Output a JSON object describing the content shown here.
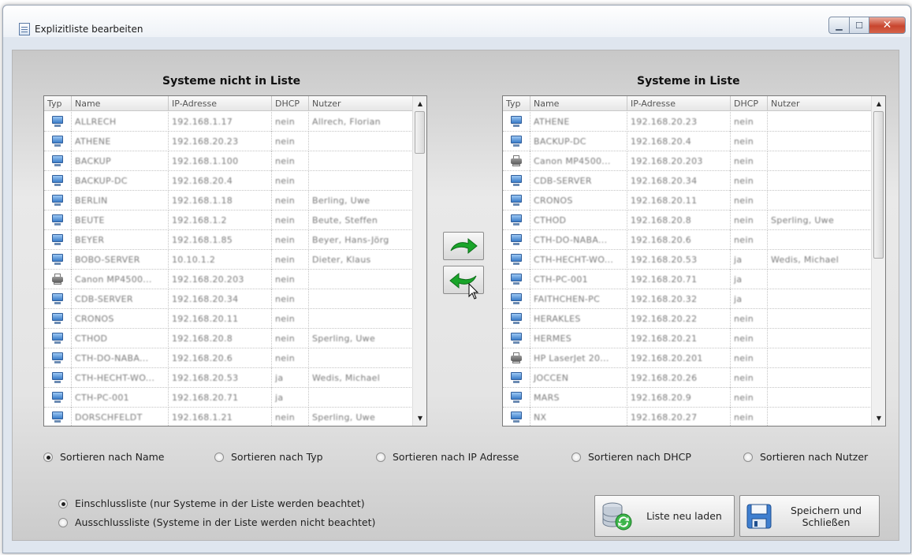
{
  "window": {
    "title": "Explizitliste bearbeiten"
  },
  "left_list": {
    "heading": "Systeme nicht in Liste",
    "columns": [
      "Typ",
      "Name",
      "IP-Adresse",
      "DHCP",
      "Nutzer"
    ],
    "rows": [
      {
        "type": "pc",
        "name": "ALLRECH",
        "ip": "192.168.1.17",
        "dhcp": "nein",
        "user": "Allrech, Florian"
      },
      {
        "type": "pc",
        "name": "ATHENE",
        "ip": "192.168.20.23",
        "dhcp": "nein",
        "user": ""
      },
      {
        "type": "pc",
        "name": "BACKUP",
        "ip": "192.168.1.100",
        "dhcp": "nein",
        "user": ""
      },
      {
        "type": "pc",
        "name": "BACKUP-DC",
        "ip": "192.168.20.4",
        "dhcp": "nein",
        "user": ""
      },
      {
        "type": "pc",
        "name": "BERLIN",
        "ip": "192.168.1.18",
        "dhcp": "nein",
        "user": "Berling, Uwe"
      },
      {
        "type": "pc",
        "name": "BEUTE",
        "ip": "192.168.1.2",
        "dhcp": "nein",
        "user": "Beute, Steffen"
      },
      {
        "type": "pc",
        "name": "BEYER",
        "ip": "192.168.1.85",
        "dhcp": "nein",
        "user": "Beyer, Hans-Jörg"
      },
      {
        "type": "pc",
        "name": "BOBO-SERVER",
        "ip": "10.10.1.2",
        "dhcp": "nein",
        "user": "Dieter, Klaus"
      },
      {
        "type": "pr",
        "name": "Canon MP4500...",
        "ip": "192.168.20.203",
        "dhcp": "nein",
        "user": ""
      },
      {
        "type": "pc",
        "name": "CDB-SERVER",
        "ip": "192.168.20.34",
        "dhcp": "nein",
        "user": ""
      },
      {
        "type": "pc",
        "name": "CRONOS",
        "ip": "192.168.20.11",
        "dhcp": "nein",
        "user": ""
      },
      {
        "type": "pc",
        "name": "CTHOD",
        "ip": "192.168.20.8",
        "dhcp": "nein",
        "user": "Sperling, Uwe"
      },
      {
        "type": "pc",
        "name": "CTH-DO-NABA...",
        "ip": "192.168.20.6",
        "dhcp": "nein",
        "user": ""
      },
      {
        "type": "pc",
        "name": "CTH-HECHT-WO...",
        "ip": "192.168.20.53",
        "dhcp": "ja",
        "user": "Wedis, Michael"
      },
      {
        "type": "pc",
        "name": "CTH-PC-001",
        "ip": "192.168.20.71",
        "dhcp": "ja",
        "user": ""
      },
      {
        "type": "pc",
        "name": "DORSCHFELDT",
        "ip": "192.168.1.21",
        "dhcp": "nein",
        "user": "Sperling, Uwe"
      }
    ]
  },
  "right_list": {
    "heading": "Systeme in Liste",
    "columns": [
      "Typ",
      "Name",
      "IP-Adresse",
      "DHCP",
      "Nutzer"
    ],
    "rows": [
      {
        "type": "pc",
        "name": "ATHENE",
        "ip": "192.168.20.23",
        "dhcp": "nein",
        "user": ""
      },
      {
        "type": "pc",
        "name": "BACKUP-DC",
        "ip": "192.168.20.4",
        "dhcp": "nein",
        "user": ""
      },
      {
        "type": "pr",
        "name": "Canon MP4500...",
        "ip": "192.168.20.203",
        "dhcp": "nein",
        "user": ""
      },
      {
        "type": "pc",
        "name": "CDB-SERVER",
        "ip": "192.168.20.34",
        "dhcp": "nein",
        "user": ""
      },
      {
        "type": "pc",
        "name": "CRONOS",
        "ip": "192.168.20.11",
        "dhcp": "nein",
        "user": ""
      },
      {
        "type": "pc",
        "name": "CTHOD",
        "ip": "192.168.20.8",
        "dhcp": "nein",
        "user": "Sperling, Uwe"
      },
      {
        "type": "pc",
        "name": "CTH-DO-NABA...",
        "ip": "192.168.20.6",
        "dhcp": "nein",
        "user": ""
      },
      {
        "type": "pc",
        "name": "CTH-HECHT-WO...",
        "ip": "192.168.20.53",
        "dhcp": "ja",
        "user": "Wedis, Michael"
      },
      {
        "type": "pc",
        "name": "CTH-PC-001",
        "ip": "192.168.20.71",
        "dhcp": "ja",
        "user": ""
      },
      {
        "type": "pc",
        "name": "FAITHCHEN-PC",
        "ip": "192.168.20.32",
        "dhcp": "ja",
        "user": ""
      },
      {
        "type": "pc",
        "name": "HERAKLES",
        "ip": "192.168.20.22",
        "dhcp": "nein",
        "user": ""
      },
      {
        "type": "pc",
        "name": "HERMES",
        "ip": "192.168.20.21",
        "dhcp": "nein",
        "user": ""
      },
      {
        "type": "pr",
        "name": "HP LaserJet 20...",
        "ip": "192.168.20.201",
        "dhcp": "nein",
        "user": ""
      },
      {
        "type": "pc",
        "name": "JOCCEN",
        "ip": "192.168.20.26",
        "dhcp": "nein",
        "user": ""
      },
      {
        "type": "pc",
        "name": "MARS",
        "ip": "192.168.20.9",
        "dhcp": "nein",
        "user": ""
      },
      {
        "type": "pc",
        "name": "NX",
        "ip": "192.168.20.27",
        "dhcp": "nein",
        "user": ""
      }
    ]
  },
  "move_buttons": {
    "to_right": "move-to-list-icon",
    "to_left": "move-from-list-icon"
  },
  "sort_options": [
    {
      "label": "Sortieren nach Name",
      "checked": true
    },
    {
      "label": "Sortieren nach Typ",
      "checked": false
    },
    {
      "label": "Sortieren nach IP Adresse",
      "checked": false
    },
    {
      "label": "Sortieren nach DHCP",
      "checked": false
    },
    {
      "label": "Sortieren nach Nutzer",
      "checked": false
    }
  ],
  "list_mode": [
    {
      "label": "Einschlussliste (nur Systeme in der Liste werden beachtet)",
      "checked": true
    },
    {
      "label": "Ausschlussliste (Systeme in der Liste werden nicht beachtet)",
      "checked": false
    }
  ],
  "buttons": {
    "reload": "Liste neu laden",
    "save": "Speichern und\nSchließen"
  },
  "colors": {
    "arrow_green": "#1aa52a",
    "window_bg": "#dfe6ef",
    "close_red": "#c8452e"
  }
}
